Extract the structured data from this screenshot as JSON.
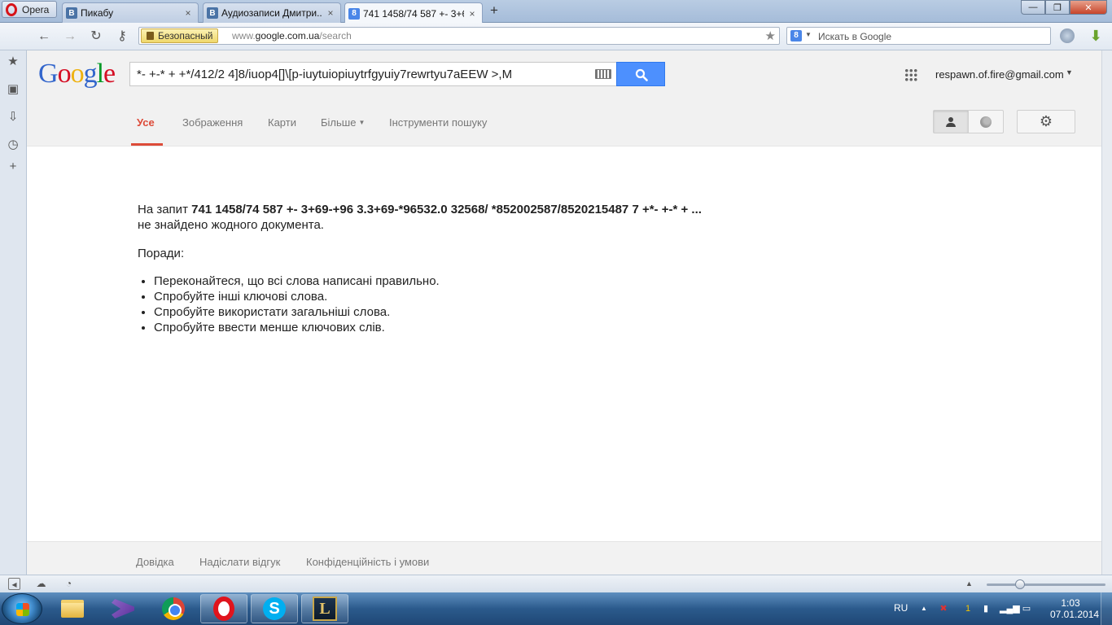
{
  "browser": {
    "app_button": "Opera",
    "tabs": [
      {
        "favicon": "В",
        "title": "Пикабу",
        "close": "×"
      },
      {
        "favicon": "В",
        "title": "Аудиозаписи Дмитри...",
        "close": "×"
      },
      {
        "favicon": "8",
        "title": "741 1458/74 587 +- 3+6...",
        "close": "×"
      }
    ],
    "new_tab": "+",
    "window_controls": {
      "minimize": "—",
      "maximize": "❐",
      "close": "✕"
    },
    "security_label": "Безопасный",
    "url_prefix": "www.",
    "url_domain": "google.com.ua",
    "url_path": "/search",
    "search_placeholder": "Искать в Google",
    "search_engine_icon": "8"
  },
  "google": {
    "logo": [
      "G",
      "o",
      "o",
      "g",
      "l",
      "e"
    ],
    "query": "*- +-* + +*/412/2 4]8/iuop4[]\\[p-iuytuiopiuytrfgyuiy7rewrtyu7aEEW  >,M",
    "account": "respawn.of.fire@gmail.com",
    "nav": {
      "all": "Усе",
      "images": "Зображення",
      "maps": "Карти",
      "more": "Більше",
      "tools": "Інструменти пошуку"
    },
    "results": {
      "prefix": "На запит ",
      "query_bold": "741 1458/74 587 +- 3+69-+96 3.3+69-*96532.0 32568/ *852002587/8520215487 7 +*- +-* + ...",
      "suffix": " не знайдено жодного документа.",
      "tips_title": "Поради:",
      "tips": [
        "Переконайтеся, що всі слова написані правильно.",
        "Спробуйте інші ключові слова.",
        "Спробуйте використати загальніші слова.",
        "Спробуйте ввести менше ключових слів."
      ]
    },
    "footer": {
      "help": "Довідка",
      "feedback": "Надіслати відгук",
      "privacy": "Конфіденційність і умови"
    }
  },
  "taskbar": {
    "skype_badge": "1",
    "lol_label": "L",
    "skype_label": "S",
    "language": "RU",
    "time": "1:03",
    "date": "07.01.2014"
  },
  "icons": {
    "side_panel": [
      "star-icon",
      "notes-icon",
      "downloads-icon",
      "history-icon",
      "add-panel-icon"
    ],
    "tray": [
      "tray-expand-icon",
      "network-icon",
      "volume-icon",
      "signal-icon",
      "power-icon"
    ]
  }
}
